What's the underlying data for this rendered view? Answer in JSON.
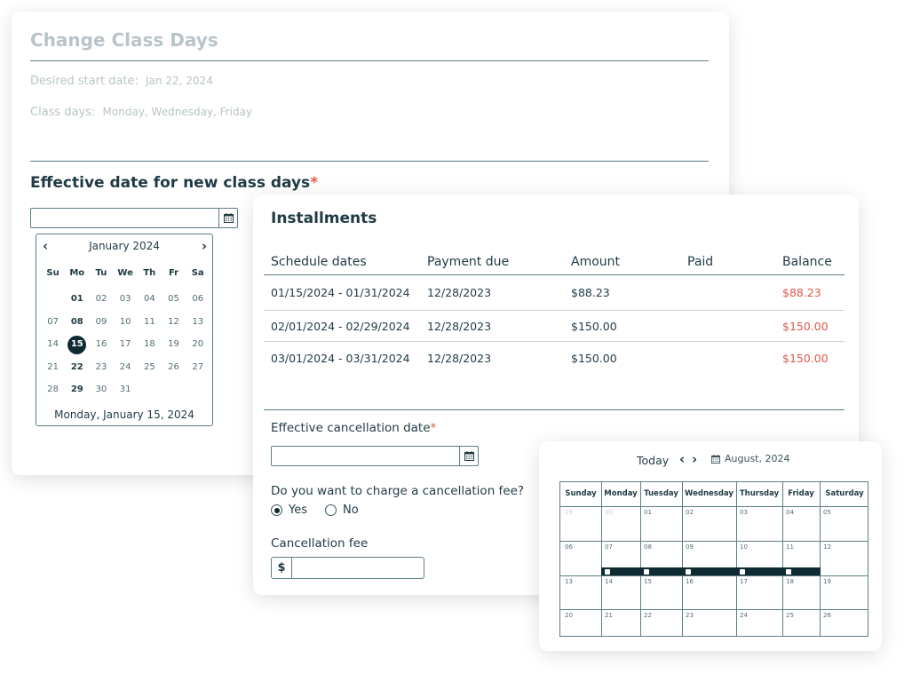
{
  "change_class_days": {
    "title": "Change Class Days",
    "desired_start_label": "Desired start date:",
    "desired_start_value": "Jan 22, 2024",
    "class_days_label": "Class days:",
    "class_days_value": "Monday, Wednesday, Friday",
    "effective_label": "Effective date for new class days",
    "required_mark": "*",
    "date_value": "",
    "mini_calendar": {
      "month_label": "January 2024",
      "prev": "‹",
      "next": "›",
      "weekdays": [
        "Su",
        "Mo",
        "Tu",
        "We",
        "Th",
        "Fr",
        "Sa"
      ],
      "weeks": [
        [
          "",
          "01",
          "02",
          "03",
          "04",
          "05",
          "06"
        ],
        [
          "07",
          "08",
          "09",
          "10",
          "11",
          "12",
          "13"
        ],
        [
          "14",
          "15",
          "16",
          "17",
          "18",
          "19",
          "20"
        ],
        [
          "21",
          "22",
          "23",
          "24",
          "25",
          "26",
          "27"
        ],
        [
          "28",
          "29",
          "30",
          "31",
          "",
          "",
          ""
        ]
      ],
      "selected": "15",
      "footer": "Monday, January 15, 2024"
    }
  },
  "installments": {
    "title": "Installments",
    "columns": [
      "Schedule dates",
      "Payment due",
      "Amount",
      "Paid",
      "Balance"
    ],
    "rows": [
      [
        "01/15/2024 - 01/31/2024",
        "12/28/2023",
        "$88.23",
        "",
        "$88.23"
      ],
      [
        "02/01/2024 - 02/29/2024",
        "12/28/2023",
        "$150.00",
        "",
        "$150.00"
      ],
      [
        "03/01/2024 - 03/31/2024",
        "12/28/2023",
        "$150.00",
        "",
        "$150.00"
      ]
    ],
    "cancellation_date_label": "Effective cancellation date",
    "required_mark": "*",
    "cancellation_date_value": "",
    "fee_question": "Do you want to charge a cancellation fee?",
    "yes_label": "Yes",
    "no_label": "No",
    "selected_option": "Yes",
    "fee_label": "Cancellation fee",
    "currency_symbol": "$",
    "fee_value": ""
  },
  "month_calendar": {
    "today_label": "Today",
    "prev": "‹",
    "next": "›",
    "month_label": "August, 2024",
    "weekdays": [
      "Sunday",
      "Monday",
      "Tuesday",
      "Wednesday",
      "Thursday",
      "Friday",
      "Saturday"
    ],
    "weeks": [
      [
        "29",
        "30",
        "01",
        "02",
        "03",
        "04",
        "05"
      ],
      [
        "06",
        "07",
        "08",
        "09",
        "10",
        "11",
        "12"
      ],
      [
        "13",
        "14",
        "15",
        "16",
        "17",
        "18",
        "19"
      ],
      [
        "20",
        "21",
        "22",
        "23",
        "24",
        "25",
        "26"
      ]
    ]
  },
  "colors": {
    "primary_dark": "#0e2a33",
    "text": "#1f3a44",
    "muted": "#b8c4c8",
    "border": "#5c7d85",
    "negative": "#e2574c"
  }
}
